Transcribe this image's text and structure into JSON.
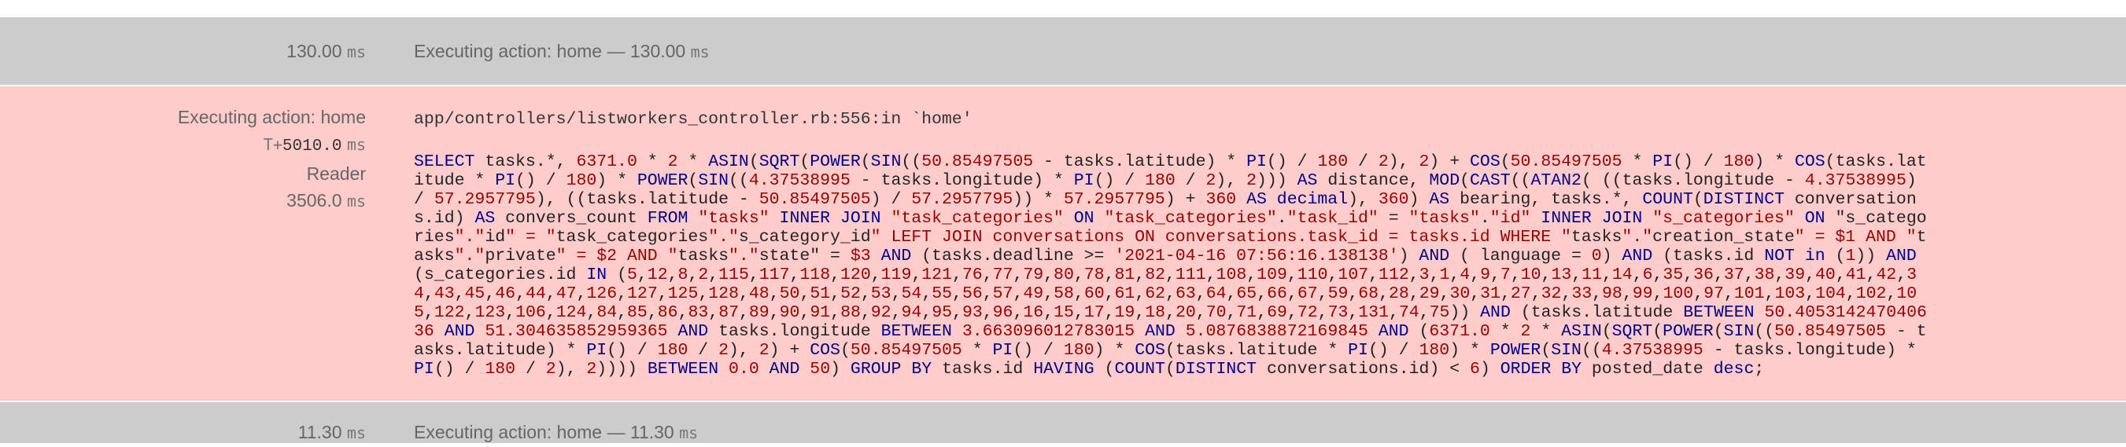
{
  "rows": [
    {
      "left_value": "130.00",
      "unit": "ms",
      "label": "Executing action: home — 130.00",
      "label_unit": "ms"
    },
    {
      "left_value": "11.30",
      "unit": "ms",
      "label": "Executing action: home — 11.30",
      "label_unit": "ms"
    }
  ],
  "query": {
    "title": "Executing action: home",
    "offset_prefix": "T+",
    "offset_value": "5010.0",
    "offset_unit": "ms",
    "db_role": "Reader",
    "duration_value": "3506.0",
    "duration_unit": "ms",
    "trace": "app/controllers/listworkers_controller.rb:556:in `home'",
    "sql_lines": [
      "SELECT tasks.*, 6371.0 * 2 * ASIN(SQRT(POWER(SIN((50.85497505 - tasks.latitude) * PI() / 180 / 2), 2) + COS(50.85497505 * PI() / 180) * COS(tasks.lat",
      "itude * PI() / 180) * POWER(SIN((4.37538995 - tasks.longitude) * PI() / 180 / 2), 2))) AS distance, MOD(CAST((ATAN2( ((tasks.longitude - 4.37538995)",
      "/ 57.2957795), ((tasks.latitude - 50.85497505) / 57.2957795)) * 57.2957795) + 360 AS decimal), 360) AS bearing, tasks.*, COUNT(DISTINCT conversation",
      "s.id) AS convers_count FROM \"tasks\" INNER JOIN \"task_categories\" ON \"task_categories\".\"task_id\" = \"tasks\".\"id\" INNER JOIN \"s_categories\" ON \"s_catego",
      "ries\".\"id\" = \"task_categories\".\"s_category_id\" LEFT JOIN conversations ON conversations.task_id = tasks.id WHERE \"tasks\".\"creation_state\" = $1 AND \"t",
      "asks\".\"private\" = $2 AND \"tasks\".\"state\" = $3 AND (tasks.deadline >= '2021-04-16 07:56:16.138138') AND ( language = 0) AND (tasks.id NOT in (1)) AND",
      "(s_categories.id IN (5,12,8,2,115,117,118,120,119,121,76,77,79,80,78,81,82,111,108,109,110,107,112,3,1,4,9,7,10,13,11,14,6,35,36,37,38,39,40,41,42,3",
      "4,43,45,46,44,47,126,127,125,128,48,50,51,52,53,54,55,56,57,49,58,60,61,62,63,64,65,66,67,59,68,28,29,30,31,27,32,33,98,99,100,97,101,103,104,102,10",
      "5,122,123,106,124,84,85,86,83,87,89,90,91,88,92,94,95,93,96,16,15,17,19,18,20,70,71,69,72,73,131,74,75)) AND (tasks.latitude BETWEEN 50.4053142470406",
      "36 AND 51.304635852959365 AND tasks.longitude BETWEEN 3.663096012783015 AND 5.0876838872169845 AND (6371.0 * 2 * ASIN(SQRT(POWER(SIN((50.85497505 - t",
      "asks.latitude) * PI() / 180 / 2), 2) + COS(50.85497505 * PI() / 180) * COS(tasks.latitude * PI() / 180) * POWER(SIN((4.37538995 - tasks.longitude) *",
      "PI() / 180 / 2), 2)))) BETWEEN 0.0 AND 50) GROUP BY tasks.id HAVING (COUNT(DISTINCT conversations.id) < 6) ORDER BY posted_date desc;"
    ]
  },
  "colors": {
    "row_gray": "#cccccc",
    "row_highlight": "#ffcccc",
    "sql_keyword": "#000088",
    "sql_literal": "#990000"
  }
}
